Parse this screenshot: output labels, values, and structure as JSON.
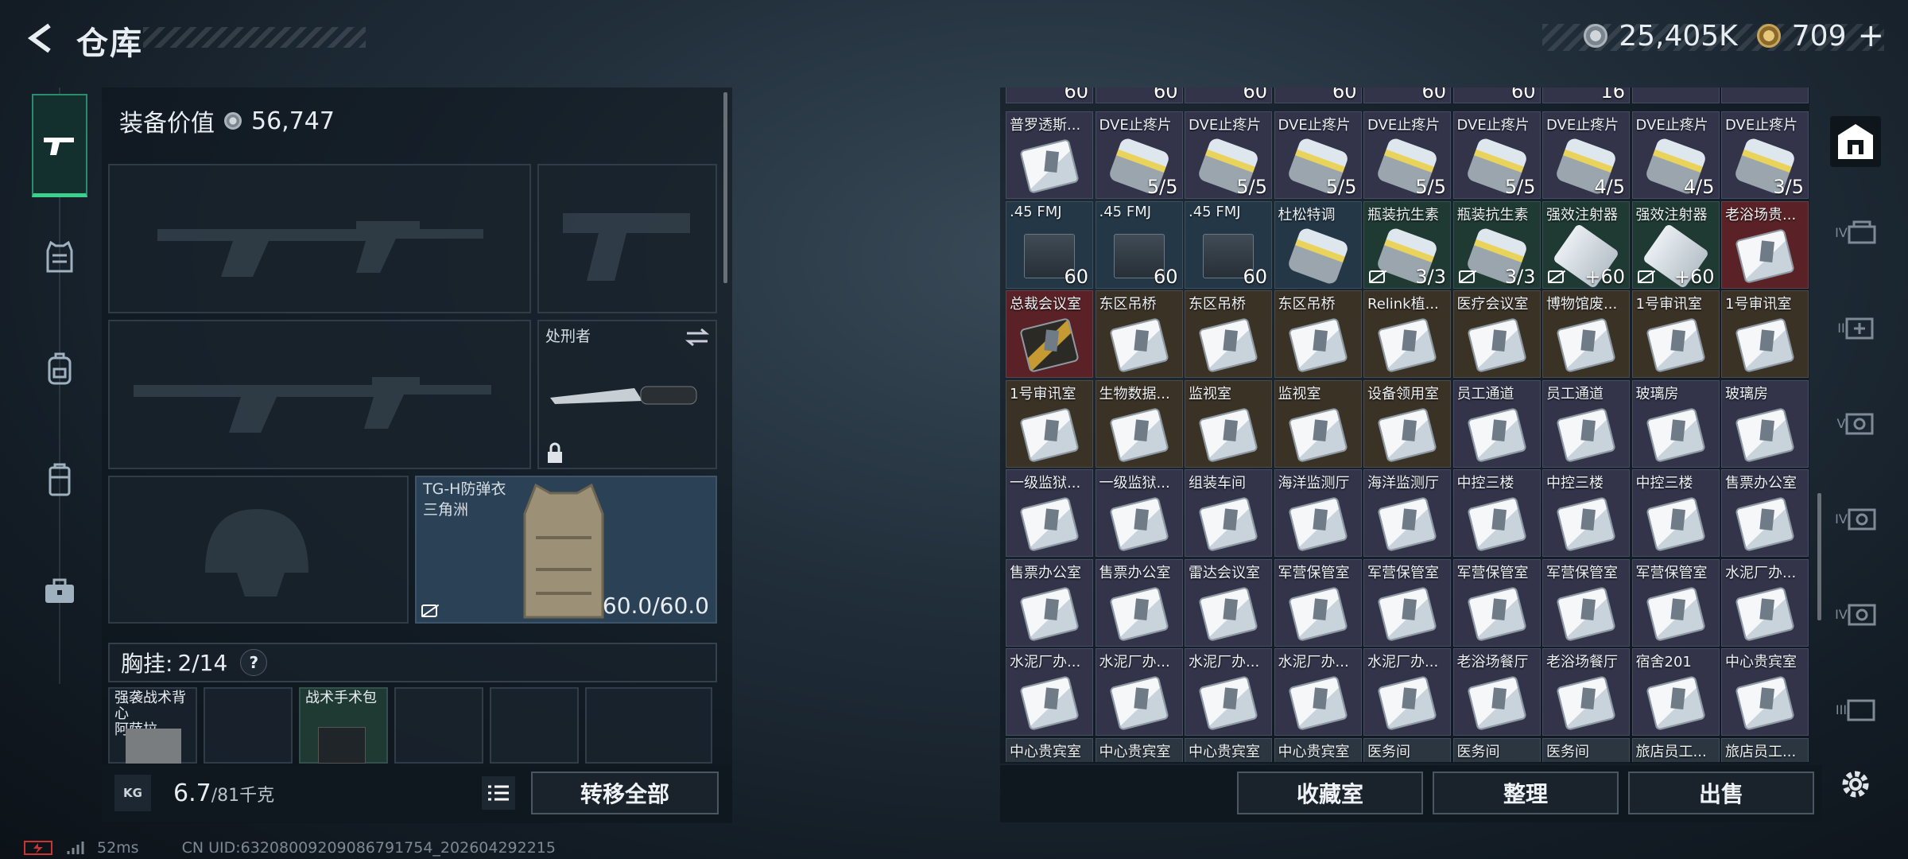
{
  "header": {
    "title": "仓库",
    "silver": "25,405K",
    "gold": "709",
    "gold_plus": "+"
  },
  "equipment_value": {
    "label": "装备价值",
    "value": "56,747"
  },
  "slots": {
    "melee": {
      "name": "处刑者"
    },
    "armor": {
      "name": "TG-H防弹衣",
      "sub": "三角洲",
      "durability": "60.0/60.0"
    }
  },
  "chest_rig": {
    "label": "胸挂:",
    "count": "2/14",
    "help": "?"
  },
  "pouches": [
    {
      "name": "强袭战术背心",
      "sub": "阿萨拉"
    },
    {
      "name": ""
    },
    {
      "name": "战术手术包",
      "sub": ""
    },
    {
      "name": ""
    },
    {
      "name": ""
    },
    {
      "name": ""
    }
  ],
  "weight": {
    "value": "6.7",
    "max": "/81千克",
    "icon": "KG"
  },
  "actions": {
    "transfer_all": "转移全部",
    "collection": "收藏室",
    "organize": "整理",
    "sell": "出售"
  },
  "status": {
    "ping": "52ms",
    "uid": "CN UID:63208009209086791754_202604292215"
  },
  "grid_top_counts": [
    "60",
    "60",
    "60",
    "60",
    "60",
    "60",
    "16",
    "",
    ""
  ],
  "grid_rows": [
    [
      {
        "name": "普罗透斯...",
        "count": "",
        "bg": "purple",
        "icon": "card"
      },
      {
        "name": "DVE止疼片",
        "count": "5/5",
        "bg": "purple",
        "icon": "pill"
      },
      {
        "name": "DVE止疼片",
        "count": "5/5",
        "bg": "purple",
        "icon": "pill"
      },
      {
        "name": "DVE止疼片",
        "count": "5/5",
        "bg": "purple",
        "icon": "pill"
      },
      {
        "name": "DVE止疼片",
        "count": "5/5",
        "bg": "purple",
        "icon": "pill"
      },
      {
        "name": "DVE止疼片",
        "count": "5/5",
        "bg": "purple",
        "icon": "pill"
      },
      {
        "name": "DVE止疼片",
        "count": "4/5",
        "bg": "purple",
        "icon": "pill"
      },
      {
        "name": "DVE止疼片",
        "count": "4/5",
        "bg": "purple",
        "icon": "pill"
      },
      {
        "name": "DVE止疼片",
        "count": "3/5",
        "bg": "purple",
        "icon": "pill"
      }
    ],
    [
      {
        "name": ".45 FMJ",
        "count": "60",
        "bg": "blue",
        "icon": "ammo"
      },
      {
        "name": ".45 FMJ",
        "count": "60",
        "bg": "blue",
        "icon": "ammo"
      },
      {
        "name": ".45 FMJ",
        "count": "60",
        "bg": "blue",
        "icon": "ammo"
      },
      {
        "name": "杜松特调",
        "count": "",
        "bg": "blue",
        "icon": "pill"
      },
      {
        "name": "瓶装抗生素",
        "count": "3/3",
        "bg": "green",
        "icon": "pill",
        "nocc": true
      },
      {
        "name": "瓶装抗生素",
        "count": "3/3",
        "bg": "green",
        "icon": "pill",
        "nocc": true
      },
      {
        "name": "强效注射器",
        "count": "+60",
        "bg": "green",
        "icon": "syringe",
        "nocc": true
      },
      {
        "name": "强效注射器",
        "count": "+60",
        "bg": "green",
        "icon": "syringe",
        "nocc": true
      },
      {
        "name": "老浴场贵...",
        "count": "",
        "bg": "red",
        "icon": "card"
      }
    ],
    [
      {
        "name": "总裁会议室",
        "count": "",
        "bg": "red",
        "icon": "gold"
      },
      {
        "name": "东区吊桥",
        "count": "",
        "bg": "brown",
        "icon": "card"
      },
      {
        "name": "东区吊桥",
        "count": "",
        "bg": "brown",
        "icon": "card"
      },
      {
        "name": "东区吊桥",
        "count": "",
        "bg": "brown",
        "icon": "card"
      },
      {
        "name": "Relink植...",
        "count": "",
        "bg": "brown",
        "icon": "card"
      },
      {
        "name": "医疗会议室",
        "count": "",
        "bg": "brown",
        "icon": "card"
      },
      {
        "name": "博物馆废...",
        "count": "",
        "bg": "brown",
        "icon": "card"
      },
      {
        "name": "1号审讯室",
        "count": "",
        "bg": "brown",
        "icon": "card"
      },
      {
        "name": "1号审讯室",
        "count": "",
        "bg": "brown",
        "icon": "card"
      }
    ],
    [
      {
        "name": "1号审讯室",
        "count": "",
        "bg": "brown",
        "icon": "card"
      },
      {
        "name": "生物数据...",
        "count": "",
        "bg": "brown",
        "icon": "card"
      },
      {
        "name": "监视室",
        "count": "",
        "bg": "brown",
        "icon": "card"
      },
      {
        "name": "监视室",
        "count": "",
        "bg": "brown",
        "icon": "card"
      },
      {
        "name": "设备领用室",
        "count": "",
        "bg": "brown",
        "icon": "card"
      },
      {
        "name": "员工通道",
        "count": "",
        "bg": "purple",
        "icon": "card"
      },
      {
        "name": "员工通道",
        "count": "",
        "bg": "purple",
        "icon": "card"
      },
      {
        "name": "玻璃房",
        "count": "",
        "bg": "purple",
        "icon": "card"
      },
      {
        "name": "玻璃房",
        "count": "",
        "bg": "purple",
        "icon": "card"
      }
    ],
    [
      {
        "name": "一级监狱...",
        "count": "",
        "bg": "purple",
        "icon": "card"
      },
      {
        "name": "一级监狱...",
        "count": "",
        "bg": "purple",
        "icon": "card"
      },
      {
        "name": "组装车间",
        "count": "",
        "bg": "purple",
        "icon": "card"
      },
      {
        "name": "海洋监测厅",
        "count": "",
        "bg": "purple",
        "icon": "card"
      },
      {
        "name": "海洋监测厅",
        "count": "",
        "bg": "purple",
        "icon": "card"
      },
      {
        "name": "中控三楼",
        "count": "",
        "bg": "purple",
        "icon": "card"
      },
      {
        "name": "中控三楼",
        "count": "",
        "bg": "purple",
        "icon": "card"
      },
      {
        "name": "中控三楼",
        "count": "",
        "bg": "purple",
        "icon": "card"
      },
      {
        "name": "售票办公室",
        "count": "",
        "bg": "purple",
        "icon": "card"
      }
    ],
    [
      {
        "name": "售票办公室",
        "count": "",
        "bg": "purple",
        "icon": "card"
      },
      {
        "name": "售票办公室",
        "count": "",
        "bg": "purple",
        "icon": "card"
      },
      {
        "name": "雷达会议室",
        "count": "",
        "bg": "purple",
        "icon": "card"
      },
      {
        "name": "军营保管室",
        "count": "",
        "bg": "purple",
        "icon": "card"
      },
      {
        "name": "军营保管室",
        "count": "",
        "bg": "purple",
        "icon": "card"
      },
      {
        "name": "军营保管室",
        "count": "",
        "bg": "purple",
        "icon": "card"
      },
      {
        "name": "军营保管室",
        "count": "",
        "bg": "purple",
        "icon": "card"
      },
      {
        "name": "军营保管室",
        "count": "",
        "bg": "purple",
        "icon": "card"
      },
      {
        "name": "水泥厂办...",
        "count": "",
        "bg": "purple",
        "icon": "card"
      }
    ],
    [
      {
        "name": "水泥厂办...",
        "count": "",
        "bg": "purple",
        "icon": "card"
      },
      {
        "name": "水泥厂办...",
        "count": "",
        "bg": "purple",
        "icon": "card"
      },
      {
        "name": "水泥厂办...",
        "count": "",
        "bg": "purple",
        "icon": "card"
      },
      {
        "name": "水泥厂办...",
        "count": "",
        "bg": "purple",
        "icon": "card"
      },
      {
        "name": "水泥厂办...",
        "count": "",
        "bg": "purple",
        "icon": "card"
      },
      {
        "name": "老浴场餐厅",
        "count": "",
        "bg": "purple",
        "icon": "card"
      },
      {
        "name": "老浴场餐厅",
        "count": "",
        "bg": "purple",
        "icon": "card"
      },
      {
        "name": "宿舍201",
        "count": "",
        "bg": "purple",
        "icon": "card"
      },
      {
        "name": "中心贵宾室",
        "count": "",
        "bg": "purple",
        "icon": "card"
      }
    ],
    [
      {
        "name": "中心贵宾室",
        "count": "",
        "bg": "gray",
        "icon": "card"
      },
      {
        "name": "中心贵宾室",
        "count": "",
        "bg": "gray",
        "icon": "card"
      },
      {
        "name": "中心贵宾室",
        "count": "",
        "bg": "gray",
        "icon": "card"
      },
      {
        "name": "中心贵宾室",
        "count": "",
        "bg": "gray",
        "icon": "card"
      },
      {
        "name": "医务间",
        "count": "",
        "bg": "gray",
        "icon": "card"
      },
      {
        "name": "医务间",
        "count": "",
        "bg": "gray",
        "icon": "card"
      },
      {
        "name": "医务间",
        "count": "",
        "bg": "gray",
        "icon": "card"
      },
      {
        "name": "旅店员工...",
        "count": "",
        "bg": "gray",
        "icon": "card"
      },
      {
        "name": "旅店员工...",
        "count": "",
        "bg": "gray",
        "icon": "card"
      }
    ]
  ],
  "right_rail": [
    "safe-box-icon",
    "IV",
    "II",
    "V",
    "IV",
    "IV",
    "III"
  ]
}
